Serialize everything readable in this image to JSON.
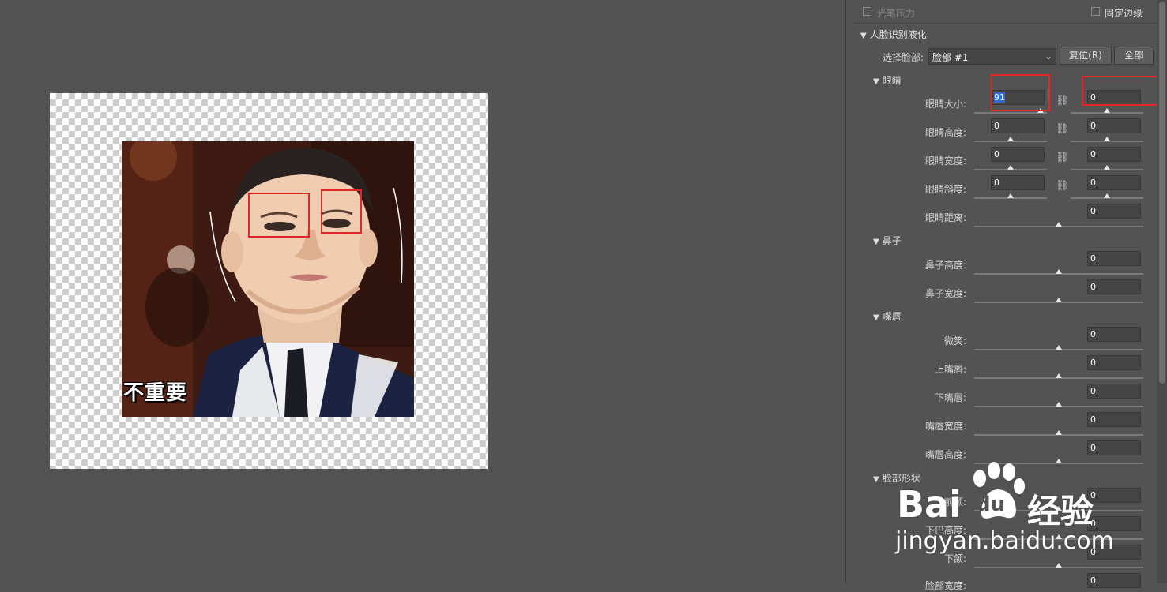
{
  "canvas": {
    "caption": "不重要"
  },
  "panel": {
    "top": {
      "pen_pressure_label": "光笔压力",
      "fix_edges_label": "固定边缘"
    },
    "face_aware": {
      "title": "人脸识别液化",
      "select_face_label": "选择脸部:",
      "select_face_value": "脸部 #1",
      "reset_button": "复位(R)",
      "all_button": "全部"
    },
    "eyes": {
      "title": "眼睛",
      "size": {
        "label": "眼睛大小:",
        "left": "91",
        "right": "0"
      },
      "height": {
        "label": "眼睛高度:",
        "left": "0",
        "right": "0"
      },
      "width": {
        "label": "眼睛宽度:",
        "left": "0",
        "right": "0"
      },
      "tilt": {
        "label": "眼睛斜度:",
        "left": "0",
        "right": "0"
      },
      "distance": {
        "label": "眼睛距离:",
        "value": "0"
      }
    },
    "nose": {
      "title": "鼻子",
      "height": {
        "label": "鼻子高度:",
        "value": "0"
      },
      "width": {
        "label": "鼻子宽度:",
        "value": "0"
      }
    },
    "mouth": {
      "title": "嘴唇",
      "smile": {
        "label": "微笑:",
        "value": "0"
      },
      "upper": {
        "label": "上嘴唇:",
        "value": "0"
      },
      "lower": {
        "label": "下嘴唇:",
        "value": "0"
      },
      "width": {
        "label": "嘴唇宽度:",
        "value": "0"
      },
      "height": {
        "label": "嘴唇高度:",
        "value": "0"
      }
    },
    "face_shape": {
      "title": "脸部形状",
      "forehead": {
        "label": "前额:",
        "value": "0"
      },
      "chin": {
        "label": "下巴高度:",
        "value": "0"
      },
      "jaw": {
        "label": "下颌:",
        "value": "0"
      },
      "face_width": {
        "label": "脸部宽度:",
        "value": "0"
      }
    }
  },
  "watermark": {
    "brand": "Bai",
    "brand2": "du",
    "jingyan": "经验",
    "url": "jingyan.baidu.com"
  },
  "colors": {
    "highlight": "#e0282a",
    "panel_bg": "#535353",
    "selection": "#2f6bd6"
  }
}
